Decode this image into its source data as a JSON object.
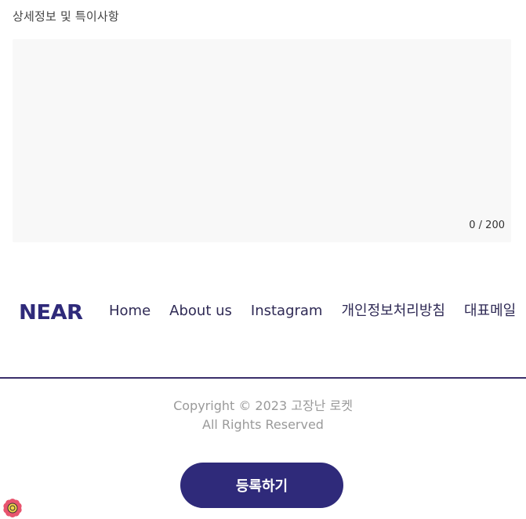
{
  "form": {
    "details_label": "상세정보 및 특이사항",
    "details_value": "",
    "char_count": "0 / 200"
  },
  "footer": {
    "logo": "NEAR",
    "nav": [
      "Home",
      "About us",
      "Instagram",
      "개인정보처리방침",
      "대표메일"
    ],
    "copyright_line1": "Copyright © 2023 고장난 로켓",
    "copyright_line2": "All Rights Reserved"
  },
  "actions": {
    "submit_label": "등록하기"
  },
  "colors": {
    "brand": "#2f2a7a",
    "textarea_bg": "#f8f8f8",
    "muted_text": "#9a9a9a"
  },
  "icons": {
    "dev_tools": "flower-devtools-icon"
  }
}
